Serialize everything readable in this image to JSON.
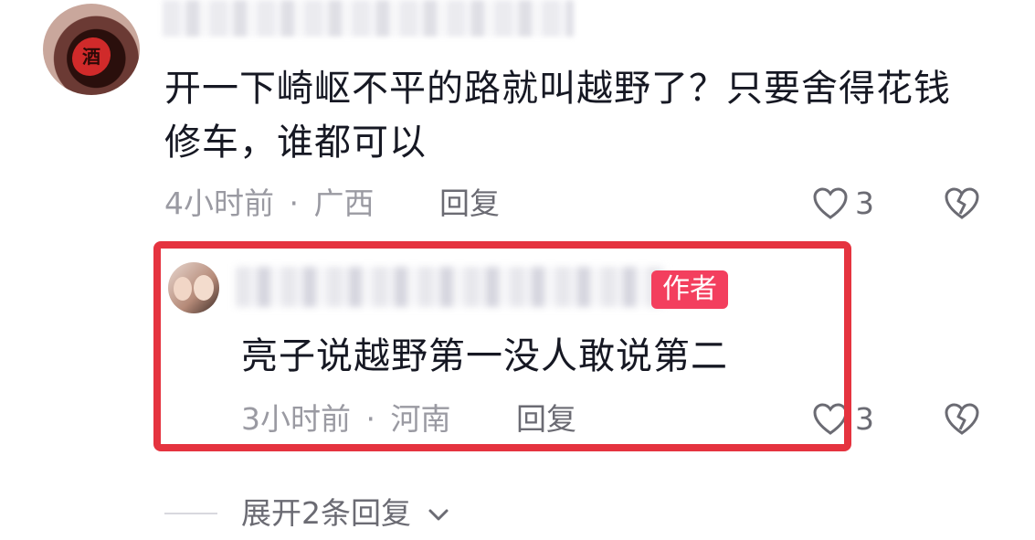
{
  "comment": {
    "text": "开一下崎岖不平的路就叫越野了？只要舍得花钱修车，谁都可以",
    "time": "4小时前",
    "separator": "·",
    "location": "广西",
    "reply_label": "回复",
    "like_count": "3",
    "avatar_text": "酒"
  },
  "reply": {
    "badge": "作者",
    "text": "亮子说越野第一没人敢说第二",
    "time": "3小时前",
    "separator": "·",
    "location": "河南",
    "reply_label": "回复",
    "like_count": "3"
  },
  "expand": {
    "label": "展开2条回复"
  },
  "colors": {
    "highlight_border": "#e5333f",
    "author_badge": "#f33f5e",
    "meta_text": "#9a9aa2"
  },
  "icons": [
    "heart-outline-icon",
    "broken-heart-icon",
    "chevron-down-icon"
  ]
}
